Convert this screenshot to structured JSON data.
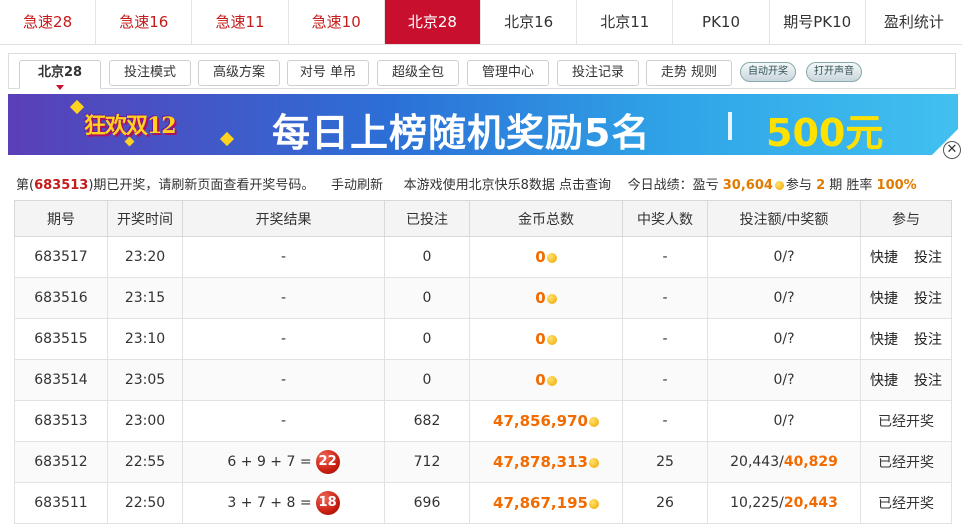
{
  "top_tabs": [
    "急速28",
    "急速16",
    "急速11",
    "急速10",
    "北京28",
    "北京16",
    "北京11",
    "PK10",
    "期号PK10",
    "盈利统计"
  ],
  "sub_tabs": [
    "北京28",
    "投注模式",
    "高级方案",
    "对号 单吊",
    "超级全包",
    "管理中心",
    "投注记录",
    "走势 规则"
  ],
  "pills": [
    "自动开奖",
    "打开声音"
  ],
  "banner": {
    "logo": "狂欢双12",
    "slogan": "每日上榜随机奖励5名",
    "amount": "500元"
  },
  "close_icon": "close-icon",
  "info": {
    "prefix": "第(",
    "period": "683513",
    "suffix": ")期已开奖，请刷新页面查看开奖号码。",
    "refresh": "手动刷新",
    "data_note": "本游戏使用北京快乐8数据 点击查询",
    "today_label": "今日战绩：盈亏",
    "profit": "30,604",
    "join_label": "参与",
    "join_count": "2",
    "period_unit": "期 胜率",
    "win_rate": "100%"
  },
  "table": {
    "headers": [
      "期号",
      "开奖时间",
      "开奖结果",
      "已投注",
      "金币总数",
      "中奖人数",
      "投注额/中奖额",
      "参与"
    ],
    "rows": [
      {
        "period": "683517",
        "time": "23:20",
        "result": "-",
        "bet": "0",
        "coins": "0",
        "winners": "-",
        "amount_a": "0",
        "amount_b": "?",
        "join_a": "快捷",
        "join_b": "投注"
      },
      {
        "period": "683516",
        "time": "23:15",
        "result": "-",
        "bet": "0",
        "coins": "0",
        "winners": "-",
        "amount_a": "0",
        "amount_b": "?",
        "join_a": "快捷",
        "join_b": "投注"
      },
      {
        "period": "683515",
        "time": "23:10",
        "result": "-",
        "bet": "0",
        "coins": "0",
        "winners": "-",
        "amount_a": "0",
        "amount_b": "?",
        "join_a": "快捷",
        "join_b": "投注"
      },
      {
        "period": "683514",
        "time": "23:05",
        "result": "-",
        "bet": "0",
        "coins": "0",
        "winners": "-",
        "amount_a": "0",
        "amount_b": "?",
        "join_a": "快捷",
        "join_b": "投注"
      },
      {
        "period": "683513",
        "time": "23:00",
        "result": "-",
        "bet": "682",
        "coins": "47,856,970",
        "winners": "-",
        "amount_a": "0",
        "amount_b": "?",
        "join_a": "已经开奖",
        "join_b": ""
      },
      {
        "period": "683512",
        "time": "22:55",
        "result": "6 + 9 + 7 =",
        "ball": "22",
        "bet": "712",
        "coins": "47,878,313",
        "winners": "25",
        "amount_a": "20,443",
        "amount_b": "40,829",
        "join_a": "已经开奖",
        "join_b": ""
      },
      {
        "period": "683511",
        "time": "22:50",
        "result": "3 + 7 + 8 =",
        "ball": "18",
        "bet": "696",
        "coins": "47,867,195",
        "winners": "26",
        "amount_a": "10,225",
        "amount_b": "20,443",
        "join_a": "已经开奖",
        "join_b": ""
      }
    ]
  }
}
